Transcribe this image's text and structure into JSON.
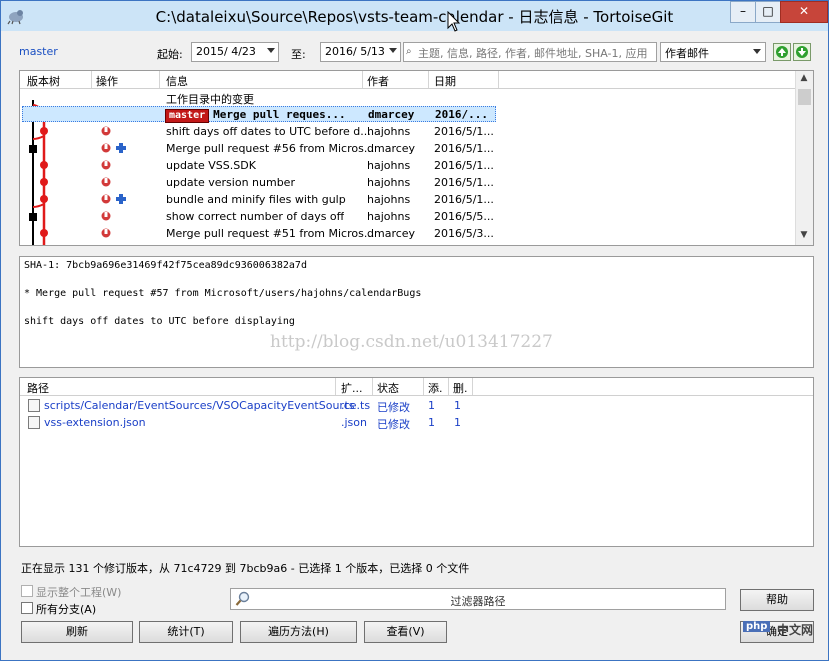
{
  "window": {
    "title": "C:\\dataleixu\\Source\\Repos\\vsts-team-calendar - 日志信息 - TortoiseGit",
    "min_label": "–",
    "max_label": "□",
    "close_label": "✕"
  },
  "toolbar": {
    "branch": "master",
    "from_label": "起始:",
    "from_date": "2015/ 4/23",
    "to_label": "至:",
    "to_date": "2016/ 5/13",
    "search_placeholder": "主题, 信息, 路径, 作者, 邮件地址, SHA-1, 应用",
    "filter_select": "作者邮件"
  },
  "log": {
    "columns": [
      "版本树",
      "操作",
      "信息",
      "作者",
      "日期"
    ],
    "rows": [
      {
        "message": "工作目录中的变更",
        "author": "",
        "date": ""
      },
      {
        "tag": "master",
        "message": "Merge pull reques...",
        "author": "dmarcey",
        "date": "2016/...",
        "selected": true
      },
      {
        "message": "shift days off dates to UTC before d...",
        "author": "hajohns",
        "date": "2016/5/1..."
      },
      {
        "message": "Merge pull request #56 from Micros...",
        "author": "dmarcey",
        "date": "2016/5/1..."
      },
      {
        "message": "update VSS.SDK",
        "author": "hajohns",
        "date": "2016/5/1..."
      },
      {
        "message": "update version number",
        "author": "hajohns",
        "date": "2016/5/1..."
      },
      {
        "message": "bundle and minify files with gulp",
        "author": "hajohns",
        "date": "2016/5/1..."
      },
      {
        "message": "show correct number of days off",
        "author": "hajohns",
        "date": "2016/5/5..."
      },
      {
        "message": "Merge pull request #51 from Micros...",
        "author": "dmarcey",
        "date": "2016/5/3..."
      }
    ]
  },
  "detail": {
    "sha": "SHA-1: 7bcb9a696e31469f42f75cea89dc936006382a7d",
    "subject": "* Merge pull request #57 from Microsoft/users/hajohns/calendarBugs",
    "body": "shift days off dates to UTC before displaying",
    "watermark": "http://blog.csdn.net/u013417227"
  },
  "files": {
    "columns": [
      "路径",
      "扩...",
      "状态",
      "添.",
      "删."
    ],
    "rows": [
      {
        "path": "scripts/Calendar/EventSources/VSOCapacityEventSource.ts",
        "ext": ".ts",
        "status": "已修改",
        "add": "1",
        "del": "1"
      },
      {
        "path": "vss-extension.json",
        "ext": ".json",
        "status": "已修改",
        "add": "1",
        "del": "1"
      }
    ]
  },
  "status_text": "正在显示 131 个修订版本，从 71c4729 到 7bcb9a6 - 已选择 1 个版本，已选择 0 个文件",
  "options": {
    "show_whole_project": "显示整个工程(W)",
    "all_branches": "所有分支(A)"
  },
  "filter_placeholder": "过滤器路径",
  "buttons": {
    "help": "帮助",
    "refresh": "刷新",
    "stats": "统计(T)",
    "walk": "遍历方法(H)",
    "view": "查看(V)",
    "ok": "确定"
  },
  "watermark_logo": {
    "left": "php",
    "right": "中文网"
  }
}
